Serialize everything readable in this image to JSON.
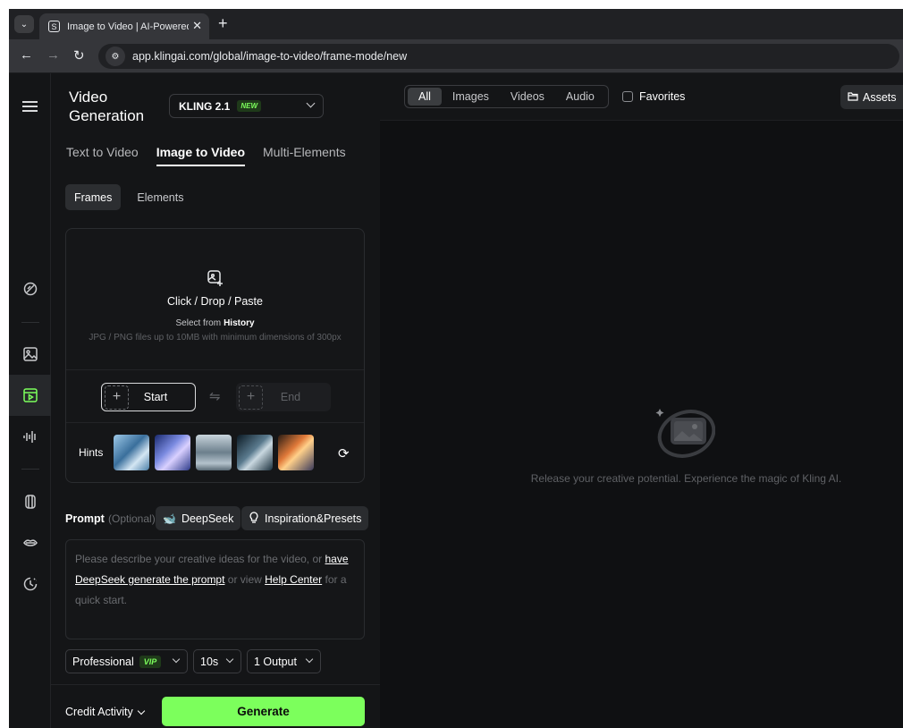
{
  "browser": {
    "tab_title": "Image to Video | AI-Powered Fr",
    "url": "app.klingai.com/global/image-to-video/frame-mode/new"
  },
  "header": {
    "title_line1": "Video",
    "title_line2": "Generation",
    "model": "KLING 2.1",
    "model_badge": "NEW"
  },
  "modes": [
    "Text to Video",
    "Image to Video",
    "Multi-Elements"
  ],
  "subtabs": [
    "Frames",
    "Elements"
  ],
  "upload": {
    "main": "Click / Drop / Paste",
    "select_from": "Select from",
    "history": "History",
    "note": "JPG / PNG files up to 10MB with minimum dimensions of 300px",
    "start_label": "Start",
    "end_label": "End",
    "hints_label": "Hints"
  },
  "prompt": {
    "label": "Prompt",
    "optional": "(Optional)",
    "deepseek_btn": "DeepSeek",
    "presets_btn": "Inspiration&Presets",
    "p1": "Please describe your creative ideas for the video, or ",
    "link1": "have DeepSeek generate the prompt",
    "p2": " or view ",
    "link2": "Help Center",
    "p3": " for a quick start."
  },
  "options": {
    "quality": "Professional",
    "quality_badge": "VIP",
    "duration": "10s",
    "outputs": "1 Output"
  },
  "footer": {
    "credit": "Credit Activity",
    "generate": "Generate"
  },
  "main": {
    "filters": [
      "All",
      "Images",
      "Videos",
      "Audio"
    ],
    "favorites": "Favorites",
    "assets": "Assets",
    "empty_text": "Release your creative potential. Experience the magic of Kling AI."
  },
  "colors": {
    "accent": "#7cff5c",
    "panel_bg": "#141517",
    "main_bg": "#0f1012"
  }
}
